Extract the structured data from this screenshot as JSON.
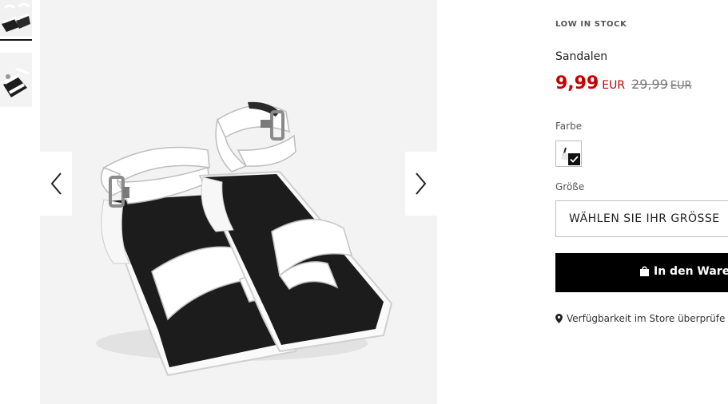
{
  "thumbnails": [
    {
      "alt": "",
      "active": true
    },
    {
      "alt": "",
      "active": false
    }
  ],
  "gallery": {
    "prev_icon": "chevron-left-icon",
    "next_icon": "chevron-right-icon"
  },
  "product": {
    "stock_label": "LOW IN STOCK",
    "name": "Sandalen",
    "price": "9,99",
    "currency": "EUR",
    "old_price": "29,99",
    "old_currency": "EUR",
    "price_color": "#c40000"
  },
  "color": {
    "label": "Farbe",
    "selected_icon": "check-icon"
  },
  "size": {
    "label": "Größe",
    "placeholder": "WÄHLEN SIE IHR GRÖSSE"
  },
  "cart": {
    "label": "In den Waren",
    "icon": "shopping-bag-icon"
  },
  "store": {
    "label": "Verfügbarkeit im Store überprüfe",
    "icon": "location-pin-icon"
  }
}
